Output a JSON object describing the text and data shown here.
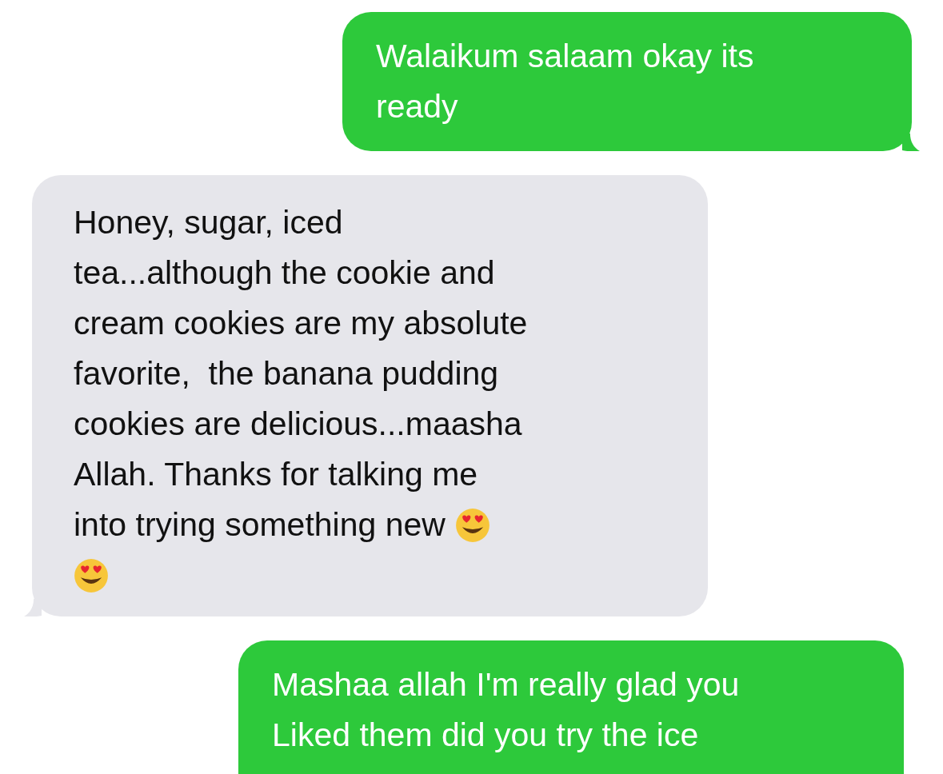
{
  "messages": [
    {
      "kind": "sent",
      "lines": [
        {
          "kind": "text",
          "text": "Walaikum salaam okay its"
        },
        {
          "kind": "text",
          "text": "ready"
        }
      ]
    },
    {
      "kind": "received",
      "lines": [
        {
          "kind": "text",
          "text": "Honey, sugar, iced"
        },
        {
          "kind": "text",
          "text": "tea...although the cookie and"
        },
        {
          "kind": "text",
          "text": "cream cookies are my absolute"
        },
        {
          "kind": "text",
          "text": "favorite,  the banana pudding"
        },
        {
          "kind": "text",
          "text": "cookies are delicious...maasha"
        },
        {
          "kind": "text",
          "text": "Allah. Thanks for talking me"
        },
        {
          "kind": "text-emoji",
          "text": "into trying something new"
        },
        {
          "kind": "emoji"
        }
      ]
    },
    {
      "kind": "sent",
      "lines": [
        {
          "kind": "text",
          "text": "Mashaa allah I'm really glad you"
        },
        {
          "kind": "text",
          "text": "Liked them did you try the ice"
        }
      ]
    }
  ]
}
